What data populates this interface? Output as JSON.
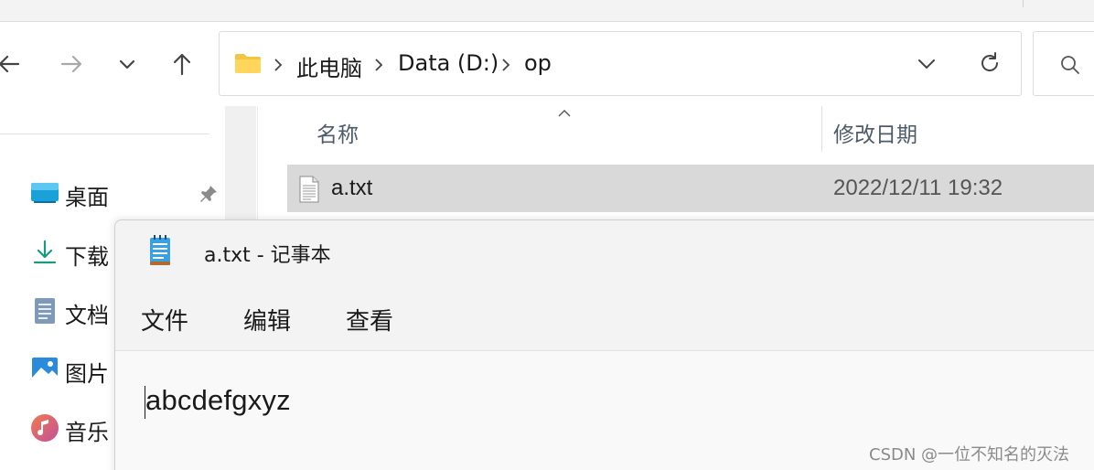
{
  "explorer": {
    "address": {
      "crumbs": [
        "此电脑",
        "Data (D:)",
        "op"
      ]
    },
    "sidebar": {
      "items": [
        {
          "label": "桌面",
          "icon": "desktop-icon"
        },
        {
          "label": "下载",
          "icon": "download-icon"
        },
        {
          "label": "文档",
          "icon": "document-icon"
        },
        {
          "label": "图片",
          "icon": "picture-icon"
        },
        {
          "label": "音乐",
          "icon": "music-icon"
        }
      ]
    },
    "columns": {
      "name": "名称",
      "modified": "修改日期"
    },
    "files": [
      {
        "name": "a.txt",
        "modified": "2022/12/11 19:32",
        "icon": "text-file-icon"
      }
    ]
  },
  "notepad": {
    "title": "a.txt - 记事本",
    "menu": [
      "文件",
      "编辑",
      "查看"
    ],
    "content": "abcdefgxyz"
  },
  "watermark": "CSDN @一位不知名的灭法",
  "colors": {
    "selection": "#d9d9d9",
    "folder": "#f4c542",
    "accent": "#0078d4"
  }
}
